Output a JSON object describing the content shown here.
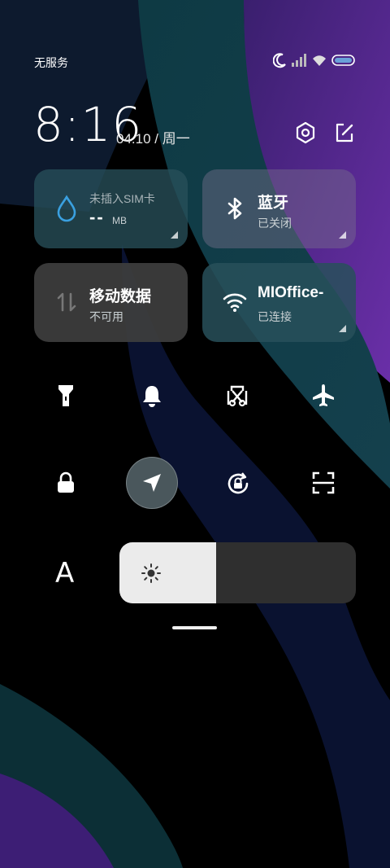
{
  "status_bar": {
    "carrier": "无服务",
    "icons": [
      "moon-icon",
      "signal-icon",
      "wifi-icon",
      "battery-icon"
    ]
  },
  "header": {
    "time": "8:16",
    "date": "04.10 / 周一",
    "icons": [
      "settings-icon",
      "edit-icon"
    ]
  },
  "tiles": [
    {
      "name": "data-usage",
      "title": "-- ",
      "unit": "MB",
      "subtitle": "未插入SIM卡",
      "icon": "water-drop-icon"
    },
    {
      "name": "bluetooth",
      "title": "蓝牙",
      "subtitle": "已关闭",
      "icon": "bluetooth-icon"
    },
    {
      "name": "mobile-data",
      "title": "移动数据",
      "subtitle": "不可用",
      "icon": "mobile-data-icon"
    },
    {
      "name": "wifi",
      "title": "MIOffice-",
      "subtitle": "已连接",
      "icon": "wifi-icon"
    }
  ],
  "toggles_row1": [
    "flashlight-icon",
    "bell-icon",
    "screenshot-icon",
    "airplane-icon"
  ],
  "toggles_row2": [
    "lock-icon",
    "location-icon",
    "auto-rotate-icon",
    "scan-icon"
  ],
  "active_toggle": "location-icon",
  "brightness": {
    "level": 0.41,
    "auto_label": "A"
  },
  "colors": {
    "tile_active": "#2f4f57",
    "tile_inactive": "#3a3a3a",
    "water_drop": "#3aa0e0",
    "brightness_fill": "#ebebeb"
  }
}
